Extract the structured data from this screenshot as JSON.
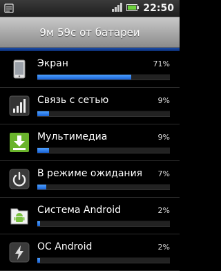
{
  "status_bar": {
    "time": "22:50",
    "icons": [
      "usb-debug-icon",
      "signal-icon",
      "battery-icon"
    ]
  },
  "header": {
    "title": "9м 59с от батареи"
  },
  "items": [
    {
      "label": "Экран",
      "percent_label": "71%",
      "fraction": 0.71,
      "icon": "screen-icon"
    },
    {
      "label": "Связь с сетью",
      "percent_label": "9%",
      "fraction": 0.09,
      "icon": "cell-signal-icon"
    },
    {
      "label": "Мультимедиа",
      "percent_label": "9%",
      "fraction": 0.09,
      "icon": "download-icon"
    },
    {
      "label": "В режиме ожидания",
      "percent_label": "7%",
      "fraction": 0.07,
      "icon": "power-icon"
    },
    {
      "label": "Система Android",
      "percent_label": "2%",
      "fraction": 0.02,
      "icon": "android-icon"
    },
    {
      "label": "ОС Android",
      "percent_label": "2%",
      "fraction": 0.02,
      "icon": "bolt-icon"
    }
  ],
  "colors": {
    "accent": "#1a63d6",
    "header": "#a8a8a8"
  }
}
